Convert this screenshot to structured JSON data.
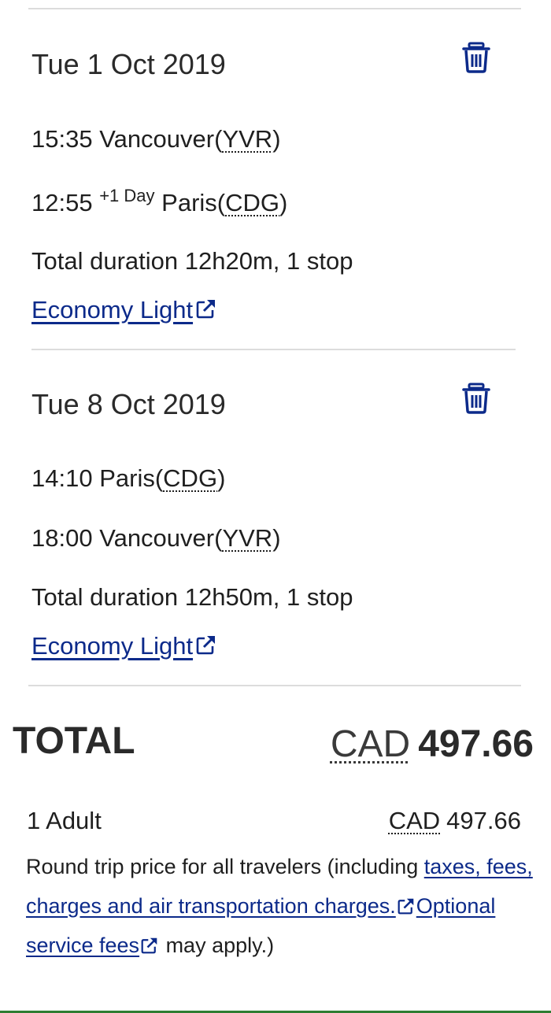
{
  "segments": [
    {
      "date": "Tue 1 Oct 2019",
      "departure": {
        "time": "15:35",
        "city": "Vancouver",
        "code": "YVR"
      },
      "arrival": {
        "time": "12:55",
        "day_offset": "+1 Day",
        "city": "Paris",
        "code": "CDG"
      },
      "duration": "Total duration 12h20m, 1 stop",
      "fare": "Economy Light"
    },
    {
      "date": "Tue 8 Oct 2019",
      "departure": {
        "time": "14:10",
        "city": "Paris",
        "code": "CDG"
      },
      "arrival": {
        "time": "18:00",
        "city": "Vancouver",
        "code": "YVR"
      },
      "duration": "Total duration 12h50m, 1 stop",
      "fare": "Economy Light"
    }
  ],
  "total": {
    "label": "TOTAL",
    "currency": "CAD",
    "amount": "497.66"
  },
  "passengers": {
    "label": "1 Adult",
    "currency": "CAD",
    "amount": "497.66"
  },
  "note": {
    "prefix": "Round trip price for all travelers (including ",
    "taxes_link": "taxes, fees, charges and air transportation charges.",
    "service_link": "Optional service fees",
    "suffix": " may apply.)"
  },
  "icons": {
    "delete": "trash-icon",
    "external": "external-link-icon"
  },
  "colors": {
    "link": "#0c2a8a",
    "text": "#1f1f1f",
    "divider": "#dcdcdc"
  }
}
